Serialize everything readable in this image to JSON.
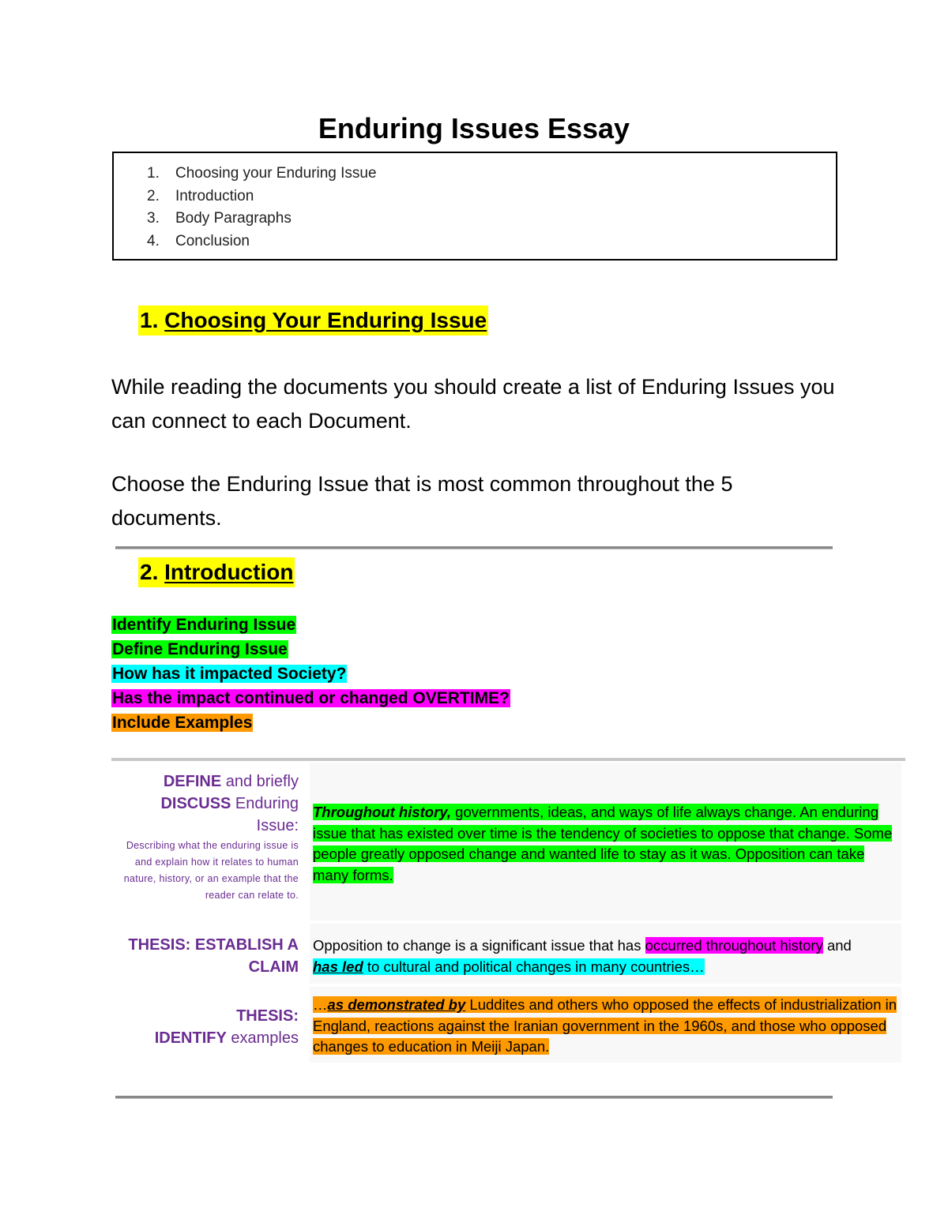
{
  "document": {
    "title": "Enduring Issues Essay"
  },
  "toc": {
    "items": [
      {
        "num": "1.",
        "label": "Choosing your Enduring Issue"
      },
      {
        "num": "2.",
        "label": "Introduction"
      },
      {
        "num": "3.",
        "label": "Body Paragraphs"
      },
      {
        "num": "4.",
        "label": "Conclusion"
      }
    ]
  },
  "section1": {
    "number": "1.",
    "heading": "Choosing Your Enduring Issue",
    "paragraph1": "While reading the documents you should create a list of Enduring Issues you can connect to each Document.",
    "paragraph2": "Choose the Enduring Issue that is most common throughout the 5 documents."
  },
  "section2": {
    "number": "2.",
    "heading": "Introduction",
    "checklist": [
      {
        "label": "Identify Enduring Issue",
        "color": "#00ff00"
      },
      {
        "label": "Define Enduring Issue",
        "color": "#00ff00"
      },
      {
        "label": "How has it impacted Society?",
        "color": "#00ffff"
      },
      {
        "label": "Has the impact continued or changed OVERTIME?",
        "color": "#ff00ff"
      },
      {
        "label": "Include Examples",
        "color": "#ff9900"
      }
    ]
  },
  "table": {
    "rows": [
      {
        "label_line1_bold": "DEFINE",
        "label_line1_rest": " and briefly",
        "label_line2_bold": "DISCUSS",
        "label_line2_rest": " Enduring",
        "label_line3": "Issue:",
        "sub_label": "Describing what the enduring issue is and explain how it relates to human nature, history, or an example that the reader can relate to.",
        "text_italic": "Throughout history,",
        "text_rest": " governments, ideas, and ways of life always change. An enduring issue that has existed over time is the tendency of societies to oppose that change. Some people greatly opposed change and wanted life to stay as it was. Opposition can take many forms.",
        "highlight": "#00ff00"
      },
      {
        "label_line1": "THESIS: ESTABLISH A",
        "label_line2": "CLAIM",
        "text_plain": "Opposition to change is a significant issue that has ",
        "text_magenta": "occurred throughout history",
        "text_and": " and",
        "text_cyan_bold": "has led",
        "text_cyan_rest": " to cultural and political changes in many countries…",
        "highlight_magenta": "#ff00ff",
        "highlight_cyan": "#00ffff"
      },
      {
        "label_line1": "THESIS:",
        "label_line2_bold": "IDENTIFY",
        "label_line2_rest": " examples",
        "text_lead": "…",
        "text_bold_underline": "as demonstrated by",
        "text_rest": " Luddites and others who opposed the effects of industrialization in England, reactions against the Iranian government in the 1960s, and those who opposed changes to education in Meiji Japan.",
        "highlight": "#ff9900"
      }
    ]
  }
}
